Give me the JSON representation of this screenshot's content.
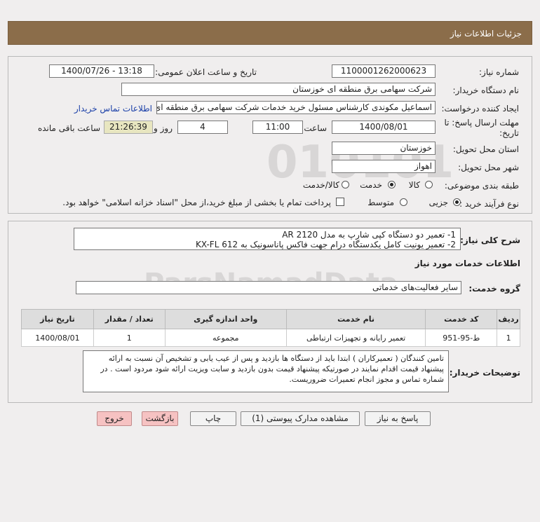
{
  "header": {
    "title": "جزئیات اطلاعات نیاز"
  },
  "need_number": {
    "label": "شماره نیاز:",
    "value": "1100001262000623"
  },
  "announce_date": {
    "label": "تاریخ و ساعت اعلان عمومی:",
    "value": "1400/07/26 - 13:18"
  },
  "buyer_org": {
    "label": "نام دستگاه خریدار:",
    "value": "شرکت سهامی برق منطقه ای خوزستان"
  },
  "requester": {
    "label": "ایجاد کننده درخواست:",
    "value": "اسماعیل مکوندی کارشناس مسئول خرید خدمات شرکت سهامی برق منطقه ای",
    "contact_link": "اطلاعات تماس خریدار"
  },
  "deadline": {
    "label_line1": "مهلت ارسال پاسخ: تا",
    "label_line2": "تاریخ:",
    "date": "1400/08/01",
    "time_label": "ساعت",
    "time": "11:00",
    "days": "4",
    "days_label": "روز و",
    "remaining": "21:26:39",
    "remaining_label": "ساعت باقی مانده"
  },
  "delivery_province": {
    "label": "استان محل تحویل:",
    "value": "خوزستان"
  },
  "delivery_city": {
    "label": "شهر محل تحویل:",
    "value": "اهواز"
  },
  "category": {
    "label": "طبقه بندی موضوعی:",
    "options": [
      "کالا",
      "خدمت",
      "کالا/خدمت"
    ],
    "selected": "خدمت"
  },
  "purchase_type": {
    "label": "نوع فرآیند خرید :",
    "options": [
      "جزیی",
      "متوسط"
    ],
    "selected": "جزیی",
    "payment_note": "پرداخت تمام یا بخشی از مبلغ خرید،از محل \"اسناد خزانه اسلامی\" خواهد بود."
  },
  "summary": {
    "label": "شرح کلی نیاز:",
    "line1": "1- تعمیر دو دستگاه کپی شارپ به مدل   AR 2120",
    "line2": "2- تعمیر یونیت کامل یکدستگاه درام جهت فاکس پاناسونیک به KX-FL 612"
  },
  "services_title": "اطلاعات خدمات مورد نیاز",
  "service_group": {
    "label": "گروه خدمت:",
    "value": "سایر فعالیت‌های خدماتی"
  },
  "table": {
    "headers": [
      "ردیف",
      "کد خدمت",
      "نام خدمت",
      "واحد اندازه گیری",
      "تعداد / مقدار",
      "تاریخ نیاز"
    ],
    "rows": [
      [
        "1",
        "ط-95-951",
        "تعمیر رایانه و تجهیزات ارتباطی",
        "مجموعه",
        "1",
        "1400/08/01"
      ]
    ]
  },
  "buyer_notes": {
    "label": "توضیحات خریدار:",
    "text": "تامین کنندگان ( تعمیرکاران ) ابتدا باید از دستگاه ها بازدید و پس از عیب یابی و تشخیص آن نسبت به ارائه پیشنهاد قیمت اقدام نمایند در صورتیکه پیشنهاد قیمت بدون بازدید و سابت ویزیت ارائه شود مردود است . در شماره تماس و مجوز انجام تعمیرات ضروریست."
  },
  "buttons": {
    "reply": "پاسخ به نیاز",
    "attachments": "مشاهده مدارک پیوستی (1)",
    "print": "چاپ",
    "back": "بازگشت",
    "exit": "خروج"
  },
  "watermark": {
    "brand": "ParsNamadData",
    "code": "010101"
  },
  "colors": {
    "header": "#8b6d4a",
    "link": "#1a3fa8",
    "exit_button": "#f6c2c2"
  }
}
